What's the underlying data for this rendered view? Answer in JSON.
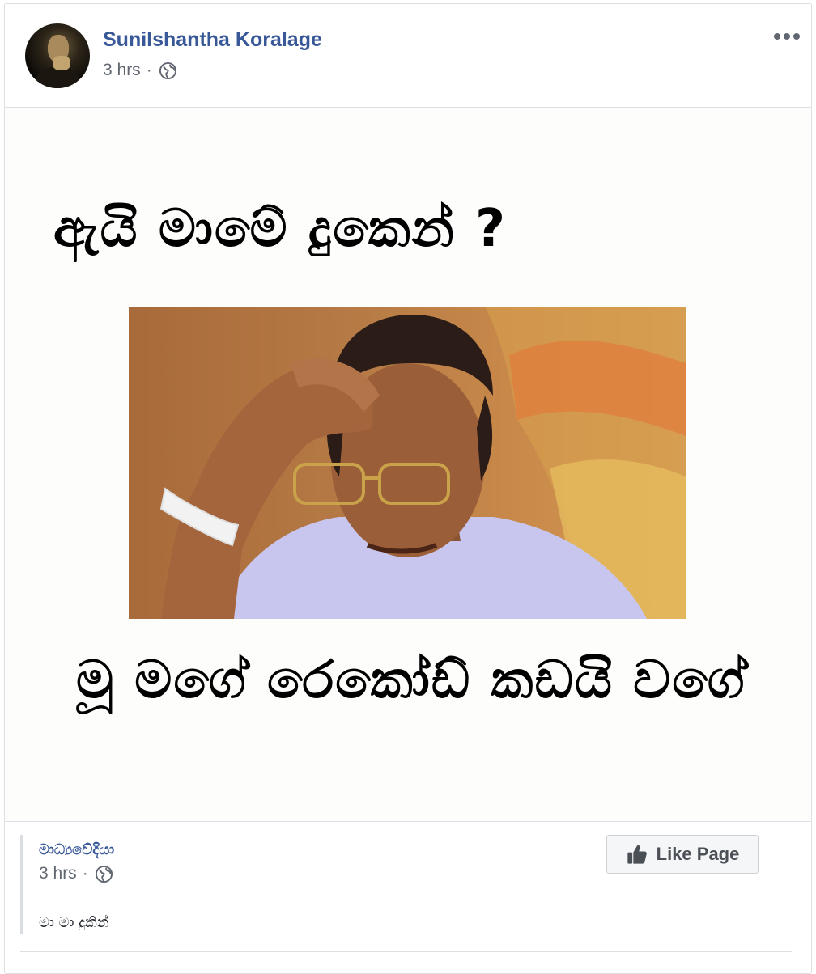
{
  "post": {
    "author": "Sunilshantha Koralage",
    "time": "3 hrs",
    "separator": "·",
    "privacy_icon": "globe-icon",
    "more_icon": "more-options-icon"
  },
  "meme": {
    "top_text": "ඇයි මාමේ දුකෙන් ?",
    "bottom_text": "මූ මගේ රෙකෝඩ් කඩයි වගේ"
  },
  "shared_page": {
    "name": "මාධ්‍යවේදියා",
    "time": "3 hrs",
    "separator": "·",
    "description": "මා මා දුකින්",
    "like_button_label": "Like Page",
    "like_icon": "thumbs-up-icon"
  },
  "colors": {
    "link_blue": "#385898",
    "meta_gray": "#616770",
    "border": "#dddfe2"
  }
}
